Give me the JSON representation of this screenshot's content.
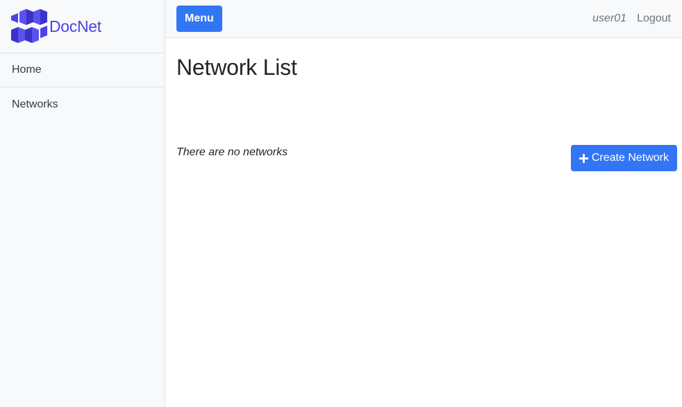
{
  "brand": {
    "name": "DocNet",
    "color": "#4c43e8"
  },
  "sidebar": {
    "items": [
      {
        "label": "Home"
      },
      {
        "label": "Networks"
      }
    ]
  },
  "topbar": {
    "menu_label": "Menu",
    "username": "user01",
    "logout_label": "Logout"
  },
  "main": {
    "title": "Network List",
    "empty_message": "There are no networks",
    "create_button_label": "Create Network",
    "create_button_icon": "plus-icon"
  },
  "colors": {
    "primary": "#3276f5",
    "sidebar_bg": "#f8f9fa",
    "border": "#dee2e6"
  }
}
